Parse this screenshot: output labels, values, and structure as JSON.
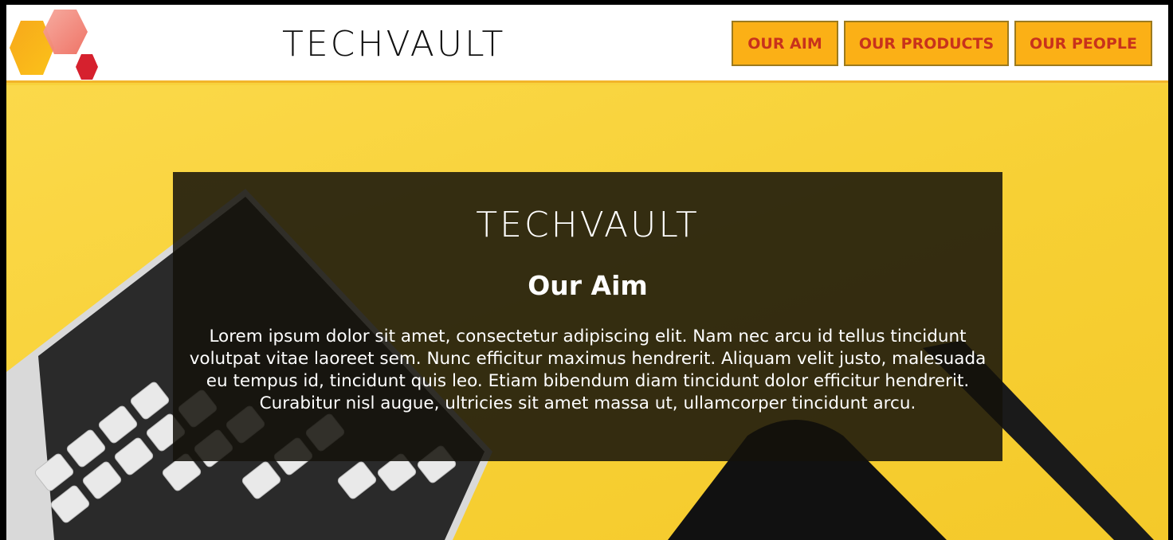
{
  "header": {
    "logo": "hexagon-cluster-logo",
    "brand": "TECHVAULT"
  },
  "nav": {
    "aim": "OUR AIM",
    "products": "OUR PRODUCTS",
    "people": "OUR PEOPLE"
  },
  "hero": {
    "brand": "TECHVAULT",
    "title": "Our Aim",
    "body": "Lorem ipsum dolor sit amet, consectetur adipiscing elit. Nam nec arcu id tellus tincidunt volutpat vitae laoreet sem. Nunc efficitur maximus hendrerit. Aliquam velit justo, malesuada eu tempus id, tincidunt quis leo. Etiam bibendum diam tincidunt dolor efficitur hendrerit. Curabitur nisl augue, ultricies sit amet massa ut, ullamcorper tincidunt arcu."
  },
  "colors": {
    "accent": "#fbb016",
    "nav_text": "#c8321c",
    "background": "#f8d23c"
  }
}
